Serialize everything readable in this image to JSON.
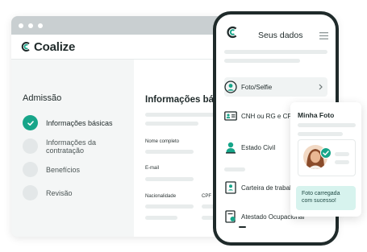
{
  "app": {
    "name": "Coalize"
  },
  "sidebar": {
    "title": "Admissão",
    "steps": [
      {
        "label": "Informações básicas",
        "status": "done"
      },
      {
        "label": "Informações da contratação",
        "status": "pending"
      },
      {
        "label": "Benefícios",
        "status": "pending"
      },
      {
        "label": "Revisão",
        "status": "pending"
      }
    ]
  },
  "main": {
    "title": "Informações básicas",
    "fields": {
      "full_name": "Nome completo",
      "email": "E-mail",
      "nationality": "Nacionalidade",
      "cpf": "CPF"
    }
  },
  "phone": {
    "title": "Seus dados",
    "items": [
      {
        "label": "Foto/Selfie",
        "icon": "user-circle-icon"
      },
      {
        "label": "CNH ou RG e CPF",
        "icon": "id-card-icon"
      },
      {
        "label": "Estado Civil",
        "icon": "person-icon"
      },
      {
        "label": "Carteira de trabalho",
        "icon": "work-card-icon"
      },
      {
        "label": "Atestado Ocupacional",
        "icon": "document-icon"
      }
    ]
  },
  "card": {
    "title": "Minha Foto",
    "toast": "Foto carregada com sucesso!"
  },
  "colors": {
    "accent": "#17a589",
    "text": "#1f2a2a",
    "toast_bg": "#d7f3ee"
  }
}
